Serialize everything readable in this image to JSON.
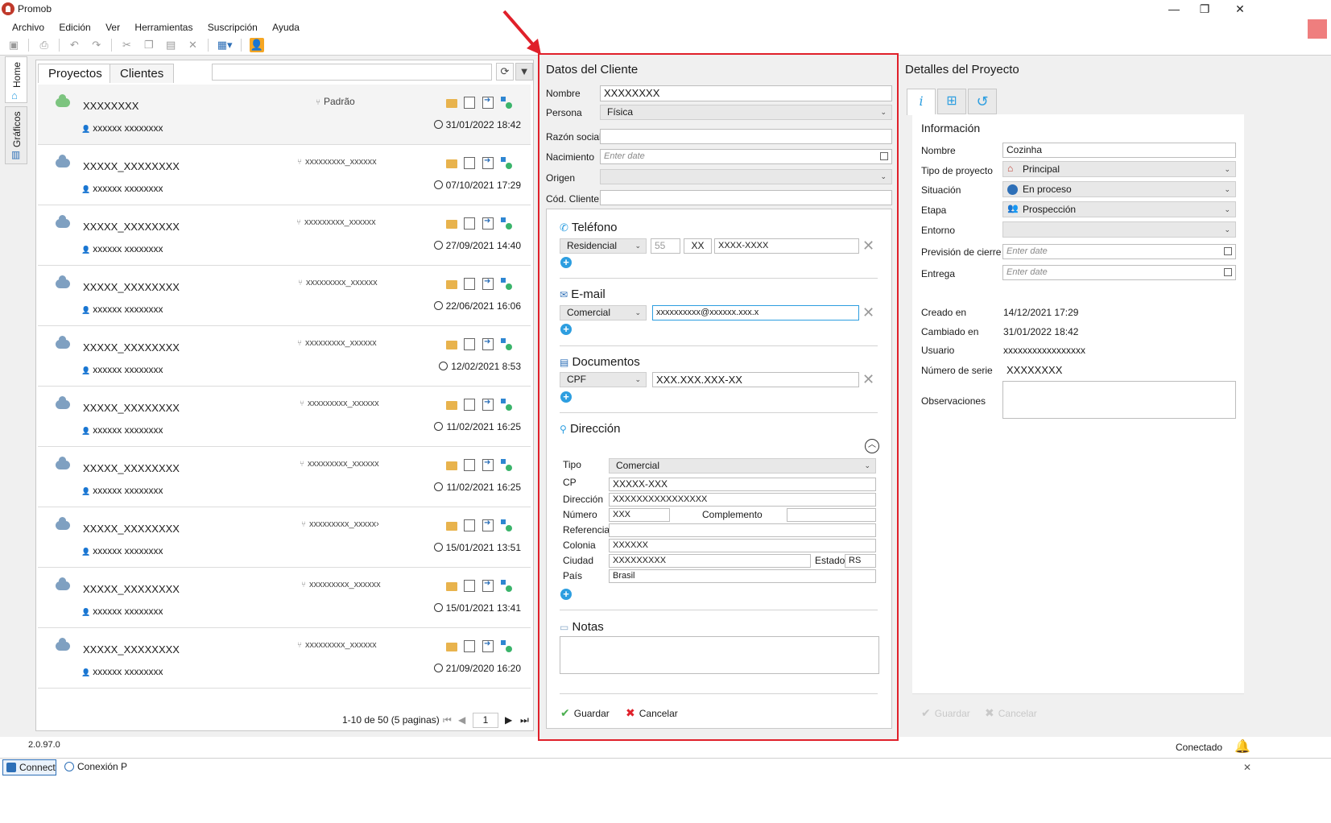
{
  "window": {
    "title": "Promob",
    "minimize": "—",
    "restore": "❐",
    "close": "✕"
  },
  "menu": [
    "Archivo",
    "Edición",
    "Ver",
    "Herramientas",
    "Suscripción",
    "Ayuda"
  ],
  "sidetabs": {
    "home": "Home",
    "graficos": "Gráficos"
  },
  "left": {
    "tabs": [
      "Proyectos",
      "Clientes"
    ],
    "search_placeholder": "",
    "projects": [
      {
        "name": "XXXXXXXX",
        "owner": "xxxxxx xxxxxxxx",
        "branch": "Padrão",
        "date": "31/01/2022 18:42",
        "cloud": "green"
      },
      {
        "name": "XXXXX_XXXXXXXX",
        "owner": "xxxxxx xxxxxxxx",
        "branch": "xxxxxxxxx_xxxxxx",
        "date": "07/10/2021 17:29",
        "cloud": "blue"
      },
      {
        "name": "XXXXX_XXXXXXXX",
        "owner": "xxxxxx xxxxxxxx",
        "branch": "xxxxxxxxx_xxxxxx",
        "date": "27/09/2021 14:40",
        "cloud": "blue"
      },
      {
        "name": "XXXXX_XXXXXXXX",
        "owner": "xxxxxx xxxxxxxx",
        "branch": "xxxxxxxxx_xxxxxx",
        "date": "22/06/2021 16:06",
        "cloud": "blue"
      },
      {
        "name": "XXXXX_XXXXXXXX",
        "owner": "xxxxxx xxxxxxxx",
        "branch": "xxxxxxxxx_xxxxxx",
        "date": "12/02/2021 8:53",
        "cloud": "blue"
      },
      {
        "name": "XXXXX_XXXXXXXX",
        "owner": "xxxxxx xxxxxxxx",
        "branch": "xxxxxxxxx_xxxxxx",
        "date": "11/02/2021 16:25",
        "cloud": "blue"
      },
      {
        "name": "XXXXX_XXXXXXXX",
        "owner": "xxxxxx xxxxxxxx",
        "branch": "xxxxxxxxx_xxxxxx",
        "date": "11/02/2021 16:25",
        "cloud": "blue"
      },
      {
        "name": "XXXXX_XXXXXXXX",
        "owner": "xxxxxx xxxxxxxx",
        "branch": "xxxxxxxxx_xxxxx›",
        "date": "15/01/2021 13:51",
        "cloud": "blue"
      },
      {
        "name": "XXXXX_XXXXXXXX",
        "owner": "xxxxxx xxxxxxxx",
        "branch": "xxxxxxxxx_xxxxxx",
        "date": "15/01/2021 13:41",
        "cloud": "blue"
      },
      {
        "name": "XXXXX_XXXXXXXX",
        "owner": "xxxxxx xxxxxxxx",
        "branch": "xxxxxxxxx_xxxxxx",
        "date": "21/09/2020 16:20",
        "cloud": "blue"
      }
    ],
    "pager": {
      "summary": "1-10 de 50 (5 paginas)",
      "page": "1"
    }
  },
  "client": {
    "title": "Datos del Cliente",
    "labels": {
      "nombre": "Nombre",
      "persona": "Persona",
      "razon": "Razón social",
      "nacimiento": "Nacimiento",
      "origen": "Origen",
      "cod": "Cód. Cliente"
    },
    "nombre": "XXXXXXXX",
    "persona": "Física",
    "razon": "",
    "nacimiento_ph": "Enter date",
    "origen": "",
    "cod": "",
    "telefono": {
      "title": "Teléfono",
      "type": "Residencial",
      "country": "55",
      "area": "XX",
      "number": "XXXX-XXXX"
    },
    "email": {
      "title": "E-mail",
      "type": "Comercial",
      "value": "xxxxxxxxxx@xxxxxx.xxx.x"
    },
    "documentos": {
      "title": "Documentos",
      "type": "CPF",
      "value": "XXX.XXX.XXX-XX"
    },
    "direccion": {
      "title": "Dirección",
      "labels": {
        "tipo": "Tipo",
        "cp": "CP",
        "direccion": "Dirección",
        "numero": "Número",
        "complemento": "Complemento",
        "referencia": "Referencia",
        "colonia": "Colonia",
        "ciudad": "Ciudad",
        "estado": "Estado",
        "pais": "País"
      },
      "tipo": "Comercial",
      "cp": "XXXXX-XXX",
      "direccion": "XXXXXXXXXXXXXXXX",
      "numero": "XXX",
      "complemento": "",
      "referencia": "",
      "colonia": "XXXXXX",
      "ciudad": "XXXXXXXXX",
      "estado": "RS",
      "pais": "Brasil"
    },
    "notas": {
      "title": "Notas"
    },
    "actions": {
      "save": "Guardar",
      "cancel": "Cancelar"
    }
  },
  "project": {
    "title": "Detalles del Proyecto",
    "section": "Información",
    "labels": {
      "nombre": "Nombre",
      "tipo": "Tipo de proyecto",
      "situacion": "Situación",
      "etapa": "Etapa",
      "entorno": "Entorno",
      "prevision": "Previsión de cierre",
      "entrega": "Entrega",
      "creado": "Creado en",
      "cambiado": "Cambiado en",
      "usuario": "Usuario",
      "serie": "Número de serie",
      "obs": "Observaciones"
    },
    "nombre": "Cozinha",
    "tipo": "Principal",
    "situacion": "En proceso",
    "etapa": "Prospección",
    "entorno": "",
    "prevision_ph": "Enter date",
    "entrega_ph": "Enter date",
    "creado": "14/12/2021 17:29",
    "cambiado": "31/01/2022 18:42",
    "usuario": "xxxxxxxxxxxxxxxxx",
    "serie": "XXXXXXXX",
    "actions": {
      "save": "Guardar",
      "cancel": "Cancelar"
    }
  },
  "status": {
    "version": "2.0.97.0",
    "connection": "Conectado"
  },
  "taskbar": [
    "Connect",
    "Conexión P"
  ],
  "colors": {
    "accent_red": "#e0202a",
    "link_blue": "#2d9ee0",
    "cloud_blue": "#7fa0c1",
    "cloud_green": "#7cc47f"
  }
}
